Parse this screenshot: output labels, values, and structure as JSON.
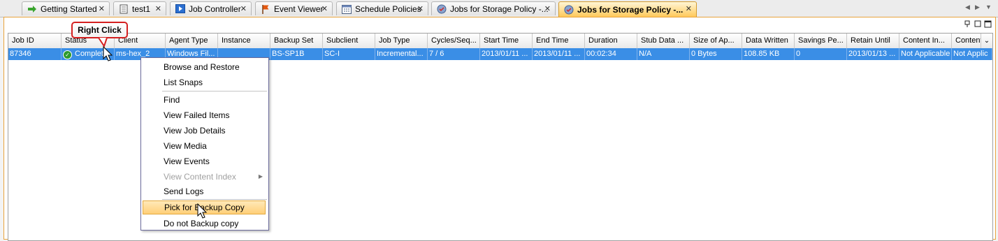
{
  "tabs": [
    {
      "label": "Getting Started",
      "icon": "green-arrow-icon",
      "active": false
    },
    {
      "label": "test1",
      "icon": "document-icon",
      "active": false
    },
    {
      "label": "Job Controller",
      "icon": "job-controller-icon",
      "active": false
    },
    {
      "label": "Event Viewer",
      "icon": "flag-icon",
      "active": false
    },
    {
      "label": "Schedule Policies",
      "icon": "calendar-icon",
      "active": false
    },
    {
      "label": "Jobs for Storage Policy -...",
      "icon": "storage-policy-icon",
      "active": false
    },
    {
      "label": "Jobs for Storage Policy -...",
      "icon": "storage-policy-icon",
      "active": true
    }
  ],
  "tab_close": "✕",
  "panel_tools": "▫▢☐",
  "columns": [
    "Job ID",
    "Status",
    "Client",
    "Agent Type",
    "Instance",
    "Backup Set",
    "Subclient",
    "Job Type",
    "Cycles/Seq...",
    "Start Time",
    "End Time",
    "Duration",
    "Stub Data ...",
    "Size of Ap...",
    "Data Written",
    "Savings Pe...",
    "Retain Until",
    "Content In...",
    "Content"
  ],
  "rows": [
    [
      "87346",
      "Complet",
      "ms-hex_2",
      "Windows Fil...",
      "",
      "BS-SP1B",
      "SC-I",
      "Incremental...",
      "7 / 6",
      "2013/01/11 ...",
      "2013/01/11 ...",
      "00:02:34",
      "N/A",
      "0 Bytes",
      "108.85 KB",
      "0",
      "2013/01/13 ...",
      "Not Applicable",
      "Not Applic"
    ]
  ],
  "context_menu": {
    "items": [
      {
        "label": "Browse and Restore",
        "enabled": true
      },
      {
        "label": "List Snaps",
        "enabled": true
      },
      {
        "label": "Find",
        "enabled": true
      },
      {
        "label": "View Failed Items",
        "enabled": true
      },
      {
        "label": "View Job Details",
        "enabled": true
      },
      {
        "label": "View Media",
        "enabled": true
      },
      {
        "label": "View Events",
        "enabled": true
      },
      {
        "label": "View Content Index",
        "enabled": false,
        "submenu": true
      },
      {
        "label": "Send Logs",
        "enabled": true
      },
      {
        "label": "Pick for Backup Copy",
        "enabled": true,
        "highlighted": true
      },
      {
        "label": "Do not Backup copy",
        "enabled": true
      }
    ]
  },
  "callout": {
    "label": "Right Click",
    "border_color": "#d42020"
  },
  "colors": {
    "selection": "#3a8ee6",
    "active_tab": "#ffc95a",
    "panel_border": "#e8a33c"
  }
}
